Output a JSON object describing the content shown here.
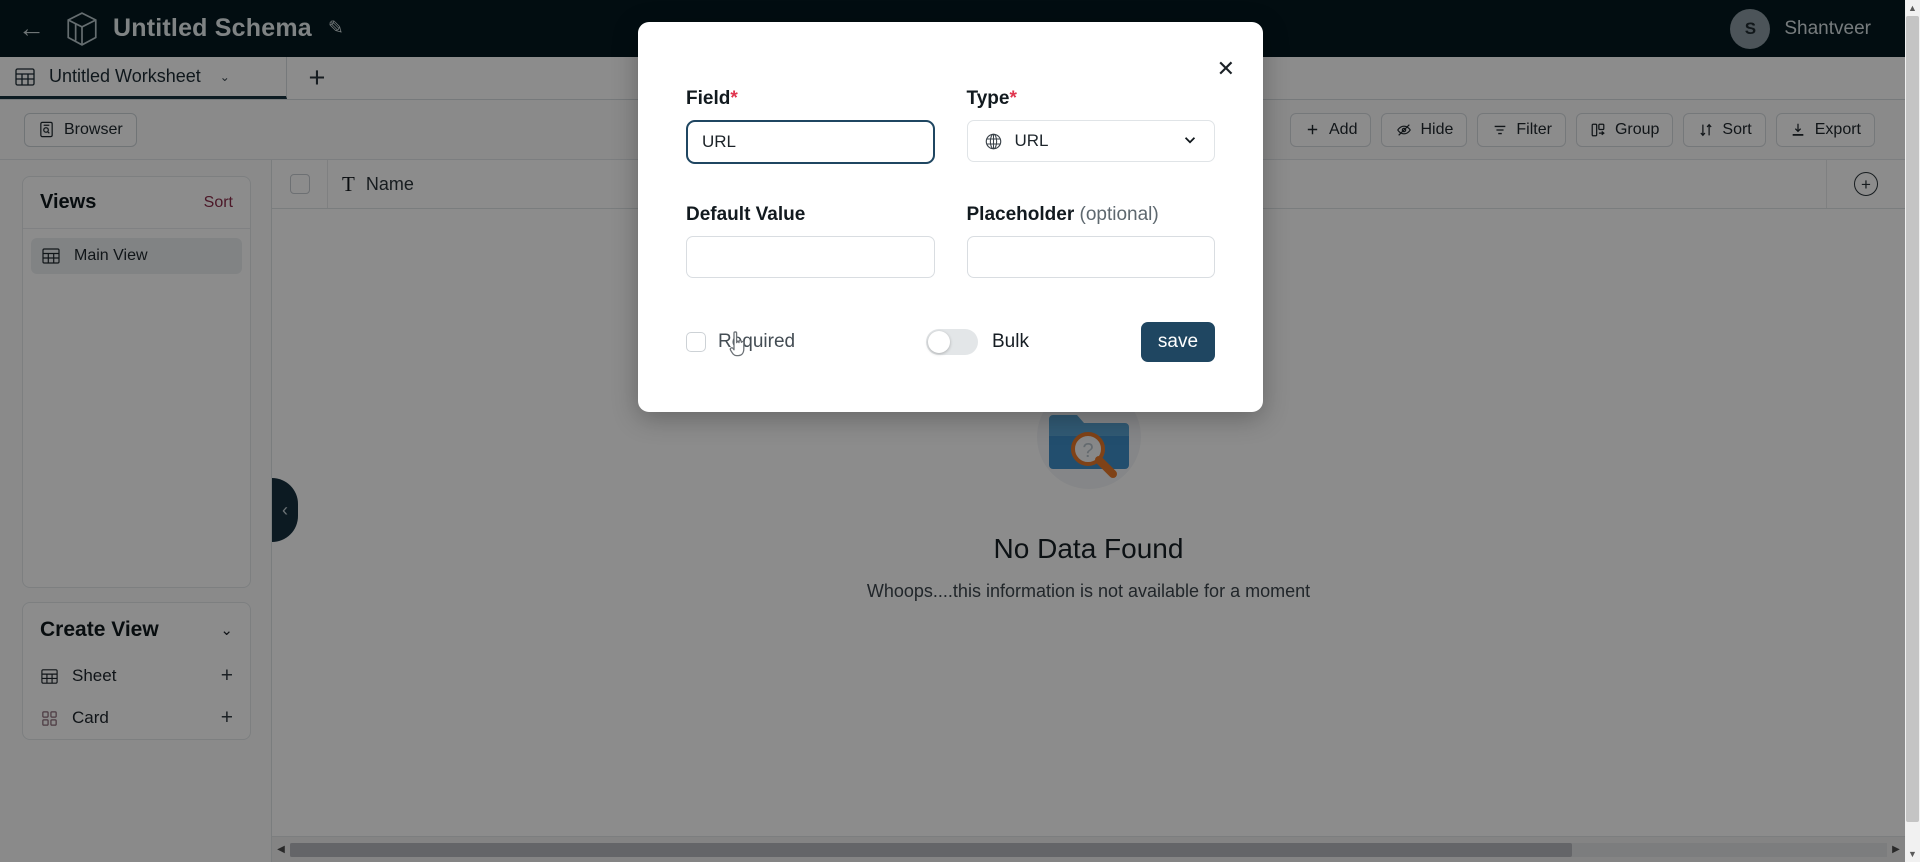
{
  "topbar": {
    "back_icon": "back-arrow-icon",
    "logo_icon": "cube-logo-icon",
    "schema_title": "Untitled Schema",
    "edit_icon": "pencil-icon",
    "avatar_initial": "S",
    "user_name": "Shantveer"
  },
  "tabstrip": {
    "tabs": [
      {
        "icon": "grid-icon",
        "label": "Untitled Worksheet",
        "chevron": "⌄",
        "active": true
      }
    ],
    "add_tab_label": "+"
  },
  "toolbar": {
    "browser_label": "Browser",
    "browser_icon": "browser-icon",
    "actions": [
      {
        "label": "Add",
        "icon": "plus-icon"
      },
      {
        "label": "Hide",
        "icon": "eye-off-icon"
      },
      {
        "label": "Filter",
        "icon": "filter-icon"
      },
      {
        "label": "Group",
        "icon": "group-icon"
      },
      {
        "label": "Sort",
        "icon": "sort-icon"
      },
      {
        "label": "Export",
        "icon": "export-icon"
      }
    ]
  },
  "sidebar": {
    "views": {
      "title": "Views",
      "sort_label": "Sort",
      "sort_color": "#8a2c4a",
      "items": [
        {
          "label": "Main View",
          "icon": "grid-icon",
          "selected": true
        }
      ]
    },
    "create_view": {
      "title": "Create View",
      "chevron": "⌄",
      "items": [
        {
          "label": "Sheet",
          "icon": "grid-icon",
          "action": "+"
        },
        {
          "label": "Card",
          "icon": "cards-icon",
          "action": "+"
        }
      ]
    },
    "collapse_handle_icon": "chevron-left-icon"
  },
  "grid": {
    "header": {
      "select_all": "",
      "columns": [
        {
          "label": "Name",
          "type_icon": "text-type-icon",
          "sort_icon": "sort-icon",
          "menu_icon": "chevron-down-icon"
        }
      ],
      "add_column_icon": "circle-plus-icon"
    },
    "empty_state": {
      "illustration": "folder-search-icon",
      "title": "No Data Found",
      "subtitle": "Whoops....this information is not available for a moment"
    }
  },
  "modal": {
    "close_icon": "close-icon",
    "field": {
      "label": "Field",
      "required_mark": "*",
      "value": "URL",
      "placeholder": ""
    },
    "type": {
      "label": "Type",
      "required_mark": "*",
      "icon": "globe-icon",
      "selected": "URL",
      "caret": "⌄"
    },
    "default_value": {
      "label": "Default Value",
      "value": "",
      "placeholder": ""
    },
    "placeholder_field": {
      "label": "Placeholder",
      "optional_text": "(optional)",
      "value": "",
      "placeholder": ""
    },
    "required_toggle": {
      "label": "Required",
      "checked": false
    },
    "bulk_toggle": {
      "label": "Bulk",
      "checked": false
    },
    "save_label": "save",
    "save_color": "#1f4661"
  },
  "colors": {
    "topbar_bg": "#05191f",
    "accent_dark": "#16303f",
    "required_star": "#e0344e",
    "sidebar_bg": "#fbfbfc"
  }
}
